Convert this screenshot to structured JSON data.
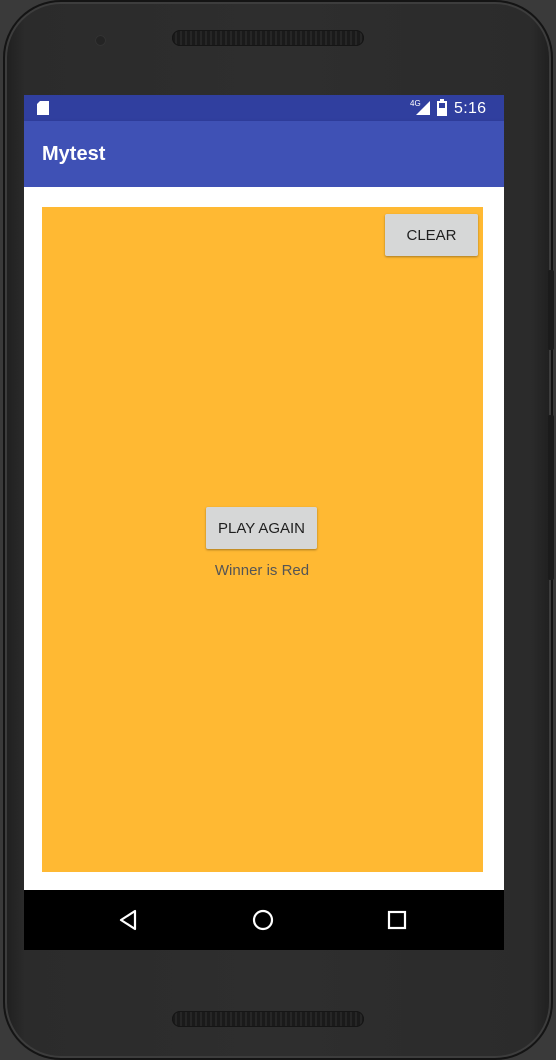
{
  "status_bar": {
    "network_label": "4G",
    "time": "5:16",
    "icons": [
      "sd-card-icon",
      "signal-icon",
      "battery-icon"
    ]
  },
  "app_bar": {
    "title": "Mytest",
    "color": "#3F51B5"
  },
  "board": {
    "background_color": "#FFB933",
    "clear_button_label": "CLEAR",
    "play_again_button_label": "PLAY AGAIN",
    "winner_text": "Winner is Red"
  },
  "nav_bar": {
    "icons": [
      "back-icon",
      "home-icon",
      "recents-icon"
    ]
  }
}
